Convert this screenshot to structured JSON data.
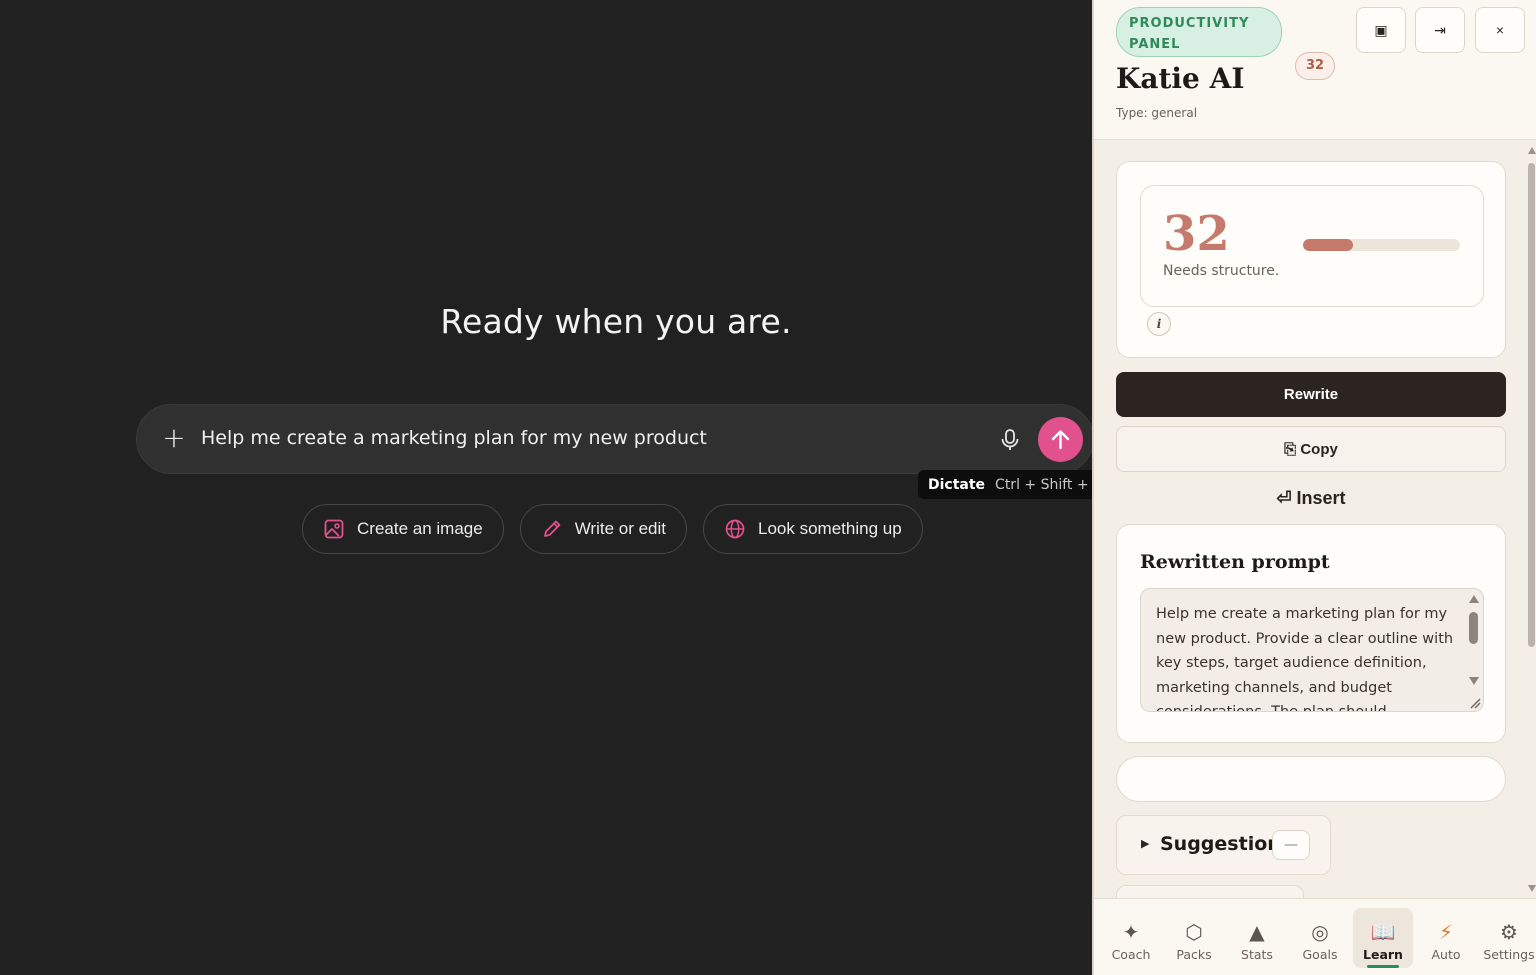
{
  "chat": {
    "headline": "Ready when you are.",
    "prompt_text": "Help me create a marketing plan for my new product",
    "tooltip": {
      "title": "Dictate",
      "keys": "Ctrl + Shift + D"
    },
    "suggestions": [
      {
        "label": "Create an image",
        "icon": "image-icon"
      },
      {
        "label": "Write or edit",
        "icon": "pencil-icon"
      },
      {
        "label": "Look something up",
        "icon": "globe-icon"
      }
    ]
  },
  "panel": {
    "pill": "PRODUCTIVITY PANEL",
    "title": "Katie AI",
    "score_badge": "32",
    "type": "Type: general",
    "header_buttons": {
      "dock": "▣",
      "collapse": "⇥",
      "close": "×"
    },
    "score": {
      "value": "32",
      "description": "Needs structure.",
      "progress_fraction": 0.32,
      "info": "i"
    },
    "rewrite_label": "Rewrite",
    "copy_label": "⎘ Copy",
    "insert_label": "⏎ Insert",
    "rewritten": {
      "title": "Rewritten prompt",
      "text": "Help me create a marketing plan for my new product. Provide a clear outline with key steps, target audience definition, marketing channels, and budget considerations. The plan should"
    },
    "suggestions_label": "Suggestions",
    "suggestions_toggle": "—",
    "nav": [
      {
        "label": "Coach",
        "icon": "✦",
        "active": false
      },
      {
        "label": "Packs",
        "icon": "⬡",
        "active": false
      },
      {
        "label": "Stats",
        "icon": "▲",
        "active": false
      },
      {
        "label": "Goals",
        "icon": "◎",
        "active": false
      },
      {
        "label": "Learn",
        "icon": "📖",
        "active": true
      },
      {
        "label": "Auto",
        "icon": "⚡",
        "active": false
      },
      {
        "label": "Settings",
        "icon": "⚙",
        "active": false
      }
    ]
  },
  "colors": {
    "accent_pink": "#e0518d",
    "score_color": "#c57a6c",
    "pill_green": "#2f8a5b",
    "dark_button": "#2c2420"
  }
}
